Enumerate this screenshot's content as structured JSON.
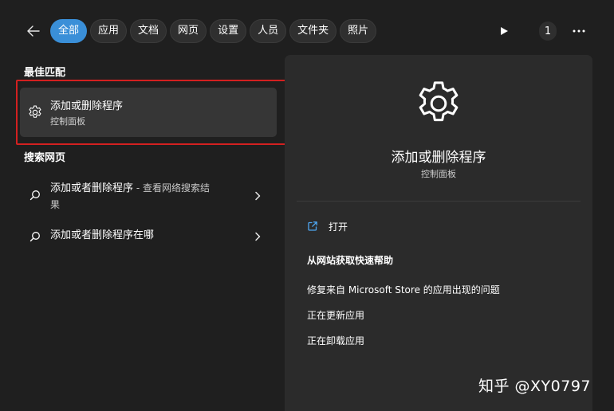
{
  "colors": {
    "background": "#1f1f1f",
    "panel": "#2b2b2b",
    "accent": "#3a8fd8",
    "highlight_border": "#d32020",
    "link_icon": "#4ea6f0"
  },
  "toolbar": {
    "back_icon": "arrow-left-icon",
    "tabs": [
      {
        "label": "全部",
        "active": true
      },
      {
        "label": "应用",
        "active": false
      },
      {
        "label": "文档",
        "active": false
      },
      {
        "label": "网页",
        "active": false
      },
      {
        "label": "设置",
        "active": false
      },
      {
        "label": "人员",
        "active": false
      },
      {
        "label": "文件夹",
        "active": false
      },
      {
        "label": "照片",
        "active": false
      }
    ],
    "play_icon": "play-icon",
    "badge_count": "1",
    "more_icon": "more-horizontal-icon"
  },
  "best_match": {
    "heading": "最佳匹配",
    "item": {
      "icon": "gear-icon",
      "title": "添加或删除程序",
      "subtitle": "控制面板"
    }
  },
  "web_search": {
    "heading": "搜索网页",
    "results": [
      {
        "icon": "search-icon",
        "query": "添加或者删除程序",
        "suffix_line1": " - 查看网络搜索结",
        "suffix_line2": "果"
      },
      {
        "icon": "search-icon",
        "query": "添加或者删除程序在哪"
      }
    ]
  },
  "preview": {
    "icon": "gear-icon",
    "title": "添加或删除程序",
    "subtitle": "控制面板",
    "open_label": "打开",
    "help_heading": "从网站获取快速帮助",
    "help_links": [
      "修复来自 Microsoft Store 的应用出现的问题",
      "正在更新应用",
      "正在卸载应用"
    ]
  },
  "watermark": "知乎 @XY0797"
}
